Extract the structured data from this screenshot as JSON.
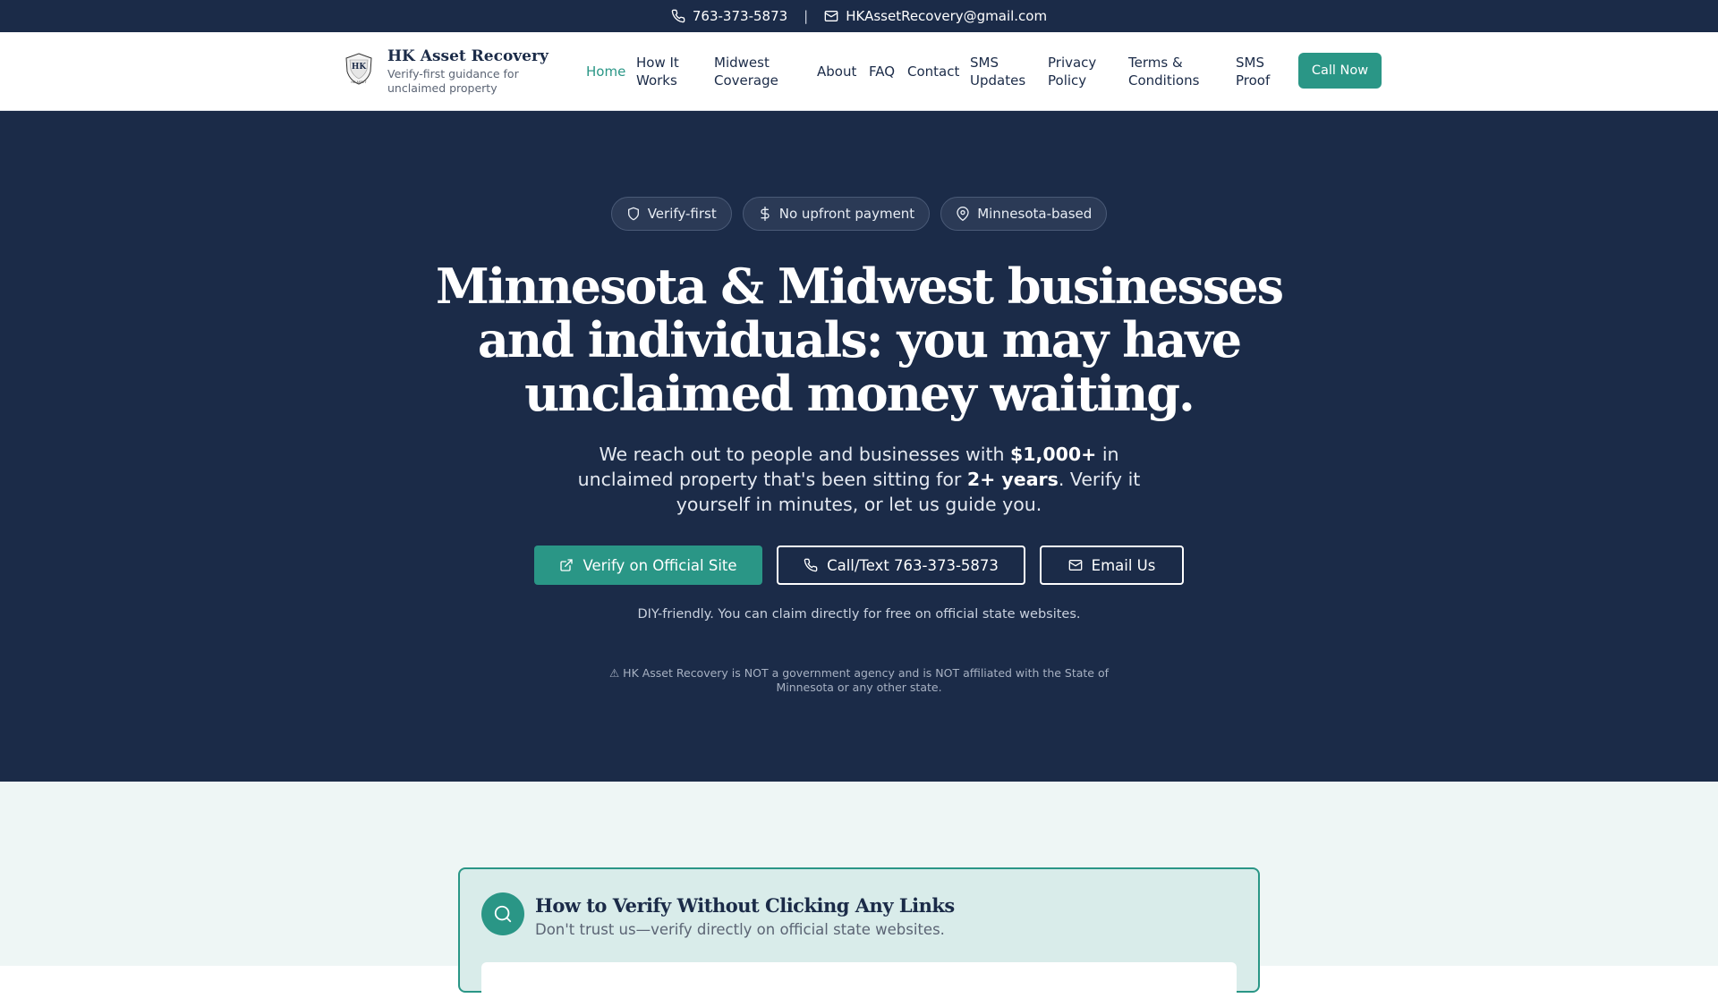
{
  "topbar": {
    "phone": "763-373-5873",
    "separator": "|",
    "email": "HKAssetRecovery@gmail.com",
    "phone_icon": "phone-icon",
    "email_icon": "mail-icon"
  },
  "brand": {
    "title": "HK Asset Recovery",
    "tagline": "Verify-first guidance for unclaimed property",
    "logo_text": "HK",
    "logo_subtext": "HK ASSET"
  },
  "nav": {
    "items": [
      {
        "label": "Home",
        "active": true
      },
      {
        "label": "How It Works"
      },
      {
        "label": "Midwest Coverage"
      },
      {
        "label": "About"
      },
      {
        "label": "FAQ"
      },
      {
        "label": "Contact"
      },
      {
        "label": "SMS Updates"
      },
      {
        "label": "Privacy Policy"
      },
      {
        "label": "Terms & Conditions"
      },
      {
        "label": "SMS Proof"
      }
    ],
    "cta": "Call Now"
  },
  "hero": {
    "pills": [
      {
        "label": "Verify-first",
        "icon": "shield-icon"
      },
      {
        "label": "No upfront payment",
        "icon": "dollar-icon"
      },
      {
        "label": "Minnesota-based",
        "icon": "map-pin-icon"
      }
    ],
    "headline": [
      "Minnesota & Midwest businesses",
      "and individuals: you may have",
      "unclaimed money waiting."
    ],
    "sub": {
      "l1_a": "We reach out to people and businesses with ",
      "l1_b": "$1,000+",
      "l1_c": " in",
      "l2_a": "unclaimed property that's been sitting for ",
      "l2_b": "2+ years",
      "l2_c": ". Verify it",
      "l3": "yourself in minutes, or let us guide you."
    },
    "buttons": {
      "verify": "Verify on Official Site",
      "call": "Call/Text 763-373-5873",
      "email": "Email Us"
    },
    "diy_note": "DIY-friendly. You can claim directly for free on official state websites.",
    "disclaimer": [
      "⚠ HK Asset Recovery is NOT a government agency and is NOT affiliated with the State of",
      "Minnesota or any other state."
    ]
  },
  "verify_section": {
    "title": "How to Verify Without Clicking Any Links",
    "subtitle": "Don't trust us—verify directly on official state websites.",
    "icon": "search-icon"
  },
  "colors": {
    "navy": "#1b2b48",
    "teal": "#2a9686",
    "light_bg": "#eef6f5"
  }
}
